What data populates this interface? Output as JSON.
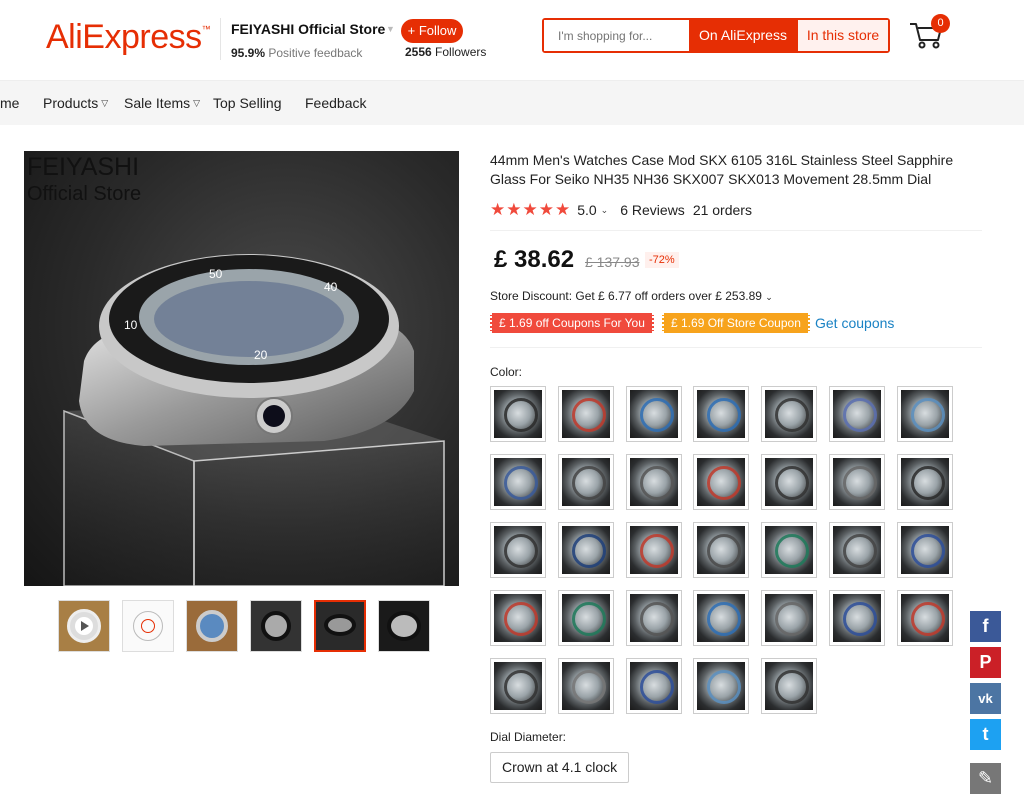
{
  "header": {
    "logo": "AliExpress",
    "store_name": "FEIYASHI Official Store",
    "follow_label": "+ Follow",
    "feedback_pct": "95.9%",
    "feedback_text": "Positive feedback",
    "followers_count": "2556",
    "followers_text": "Followers",
    "search_placeholder": "I'm shopping for...",
    "search_on_aliexpress": "On AliExpress",
    "search_in_store": "In this store",
    "cart_count": "0"
  },
  "nav": {
    "items": [
      {
        "label": "me"
      },
      {
        "label": "Products"
      },
      {
        "label": "Sale Items"
      },
      {
        "label": "Top Selling"
      },
      {
        "label": "Feedback"
      }
    ]
  },
  "gallery": {
    "watermark_line1": "FEIYASHI",
    "watermark_line2": "Official Store",
    "thumbnail_count": 6,
    "selected_thumbnail": 5
  },
  "product": {
    "title": "44mm Men's Watches Case Mod SKX 6105 316L Stainless Steel Sapphire Glass For Seiko NH35 NH36 SKX007 SKX013 Movement 28.5mm Dial",
    "rating_value": "5.0",
    "stars": 5,
    "reviews": "6 Reviews",
    "orders": "21 orders",
    "price": "£ 38.62",
    "original_price": "£ 137.93",
    "discount_pct": "-72%",
    "store_discount": "Store Discount: Get  £ 6.77 off orders over  £ 253.89",
    "coupon_for_you": "£ 1.69 off Coupons For You",
    "coupon_store": "£ 1.69 Off Store Coupon",
    "get_coupons": "Get coupons",
    "color_label": "Color:",
    "color_options": [
      {
        "bezel": "#2a2a2a"
      },
      {
        "bezel": "#c0392b"
      },
      {
        "bezel": "#2e6fb5"
      },
      {
        "bezel": "#2e6fb5"
      },
      {
        "bezel": "#333333"
      },
      {
        "bezel": "#5a6fb0"
      },
      {
        "bezel": "#5a8fc0"
      },
      {
        "bezel": "#3a5a9a"
      },
      {
        "bezel": "#444444"
      },
      {
        "bezel": "#555555"
      },
      {
        "bezel": "#c0392b"
      },
      {
        "bezel": "#333333"
      },
      {
        "bezel": "#666666"
      },
      {
        "bezel": "#2a2a2a"
      },
      {
        "bezel": "#333333"
      },
      {
        "bezel": "#1f3f7a"
      },
      {
        "bezel": "#c0392b"
      },
      {
        "bezel": "#4a4a4a"
      },
      {
        "bezel": "#1f7a5a"
      },
      {
        "bezel": "#444444"
      },
      {
        "bezel": "#2e4f9a"
      },
      {
        "bezel": "#c0392b"
      },
      {
        "bezel": "#1f7a5a"
      },
      {
        "bezel": "#555555"
      },
      {
        "bezel": "#2e6fb5"
      },
      {
        "bezel": "#666666"
      },
      {
        "bezel": "#2e4f9a"
      },
      {
        "bezel": "#c0392b"
      },
      {
        "bezel": "#333333"
      },
      {
        "bezel": "#777777"
      },
      {
        "bezel": "#2e4f9a"
      },
      {
        "bezel": "#5a8fc0"
      },
      {
        "bezel": "#333333"
      }
    ],
    "dial_label": "Dial Diameter:",
    "dial_option": "Crown at 4.1 clock"
  },
  "social": {
    "facebook": "f",
    "pinterest": "P",
    "vk": "vk",
    "twitter": "t"
  },
  "colors": {
    "brand_red": "#e62e04",
    "coupon_orange": "#f7a31c",
    "link_blue": "#1a82c4",
    "facebook": "#3b5998",
    "pinterest": "#cb2027",
    "vk": "#4c75a3",
    "twitter": "#1da1f2"
  }
}
